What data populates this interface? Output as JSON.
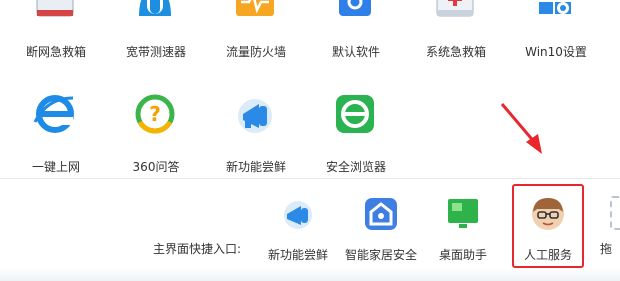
{
  "tools_row1": [
    {
      "label": "断网急救箱",
      "icon": "network-first-aid-icon"
    },
    {
      "label": "宽带测速器",
      "icon": "broadband-speedtest-icon"
    },
    {
      "label": "流量防火墙",
      "icon": "traffic-firewall-icon"
    },
    {
      "label": "默认软件",
      "icon": "default-software-icon"
    },
    {
      "label": "系统急救箱",
      "icon": "system-first-aid-icon"
    },
    {
      "label": "Win10设置",
      "icon": "win10-settings-icon"
    }
  ],
  "tools_row2": [
    {
      "label": "一键上网",
      "icon": "internet-explorer-icon"
    },
    {
      "label": "360问答",
      "icon": "qa-icon"
    },
    {
      "label": "新功能尝鲜",
      "icon": "megaphone-icon"
    },
    {
      "label": "安全浏览器",
      "icon": "secure-browser-icon"
    }
  ],
  "quick_access": {
    "label": "主界面快捷入口:",
    "items": [
      {
        "label": "新功能尝鲜",
        "icon": "megaphone-icon"
      },
      {
        "label": "智能家居安全",
        "icon": "smart-home-icon"
      },
      {
        "label": "桌面助手",
        "icon": "desktop-assistant-icon"
      },
      {
        "label": "人工服务",
        "icon": "customer-service-avatar-icon",
        "highlighted": true
      },
      {
        "label": "拖",
        "icon": "drag-placeholder-icon"
      }
    ]
  },
  "colors": {
    "highlight": "#e8262c",
    "annotation_arrow": "#e8262c"
  }
}
